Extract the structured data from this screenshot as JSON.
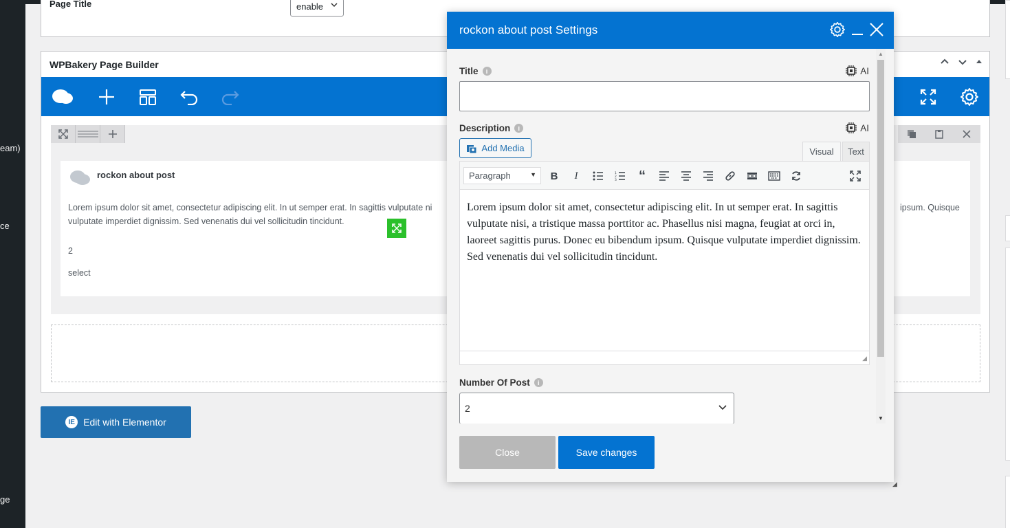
{
  "sidebar_fragments": [
    "eam)",
    "ce",
    "ge"
  ],
  "page_title_box": {
    "label": "Page Title",
    "select_value": "enable"
  },
  "wpbakery": {
    "title": "WPBakery Page Builder",
    "element": {
      "name": "rockon about post",
      "description": "Lorem ipsum dolor sit amet, consectetur adipiscing elit. In ut semper erat. In sagittis vulputate ni",
      "description_right": "ipsum. Quisque",
      "description_line2": "vulputate imperdiet dignissim. Sed venenatis dui vel sollicitudin tincidunt.",
      "number": "2",
      "select": "select"
    }
  },
  "elementor_button": "Edit with Elementor",
  "modal": {
    "title": "rockon about post Settings",
    "fields": {
      "title_label": "Title",
      "ai_label": "AI",
      "description_label": "Description",
      "add_media": "Add Media",
      "tab_visual": "Visual",
      "tab_text": "Text",
      "paragraph_select": "Paragraph",
      "editor_content": "Lorem ipsum dolor sit amet, consectetur adipiscing elit. In ut semper erat. In sagittis vulputate nisi, a tristique massa porttitor ac. Phasellus nisi magna, feugiat at orci in, laoreet sagittis purus. Donec eu bibendum ipsum. Quisque vulputate imperdiet dignissim. Sed venenatis dui vel sollicitudin tincidunt.",
      "number_label": "Number Of Post",
      "number_value": "2"
    },
    "buttons": {
      "close": "Close",
      "save": "Save changes"
    }
  },
  "colors": {
    "wpb_blue": "#0473d1",
    "admin_dark": "#1d2327",
    "handle_green": "#2bc02b",
    "close_gray": "#b8b8b8"
  }
}
